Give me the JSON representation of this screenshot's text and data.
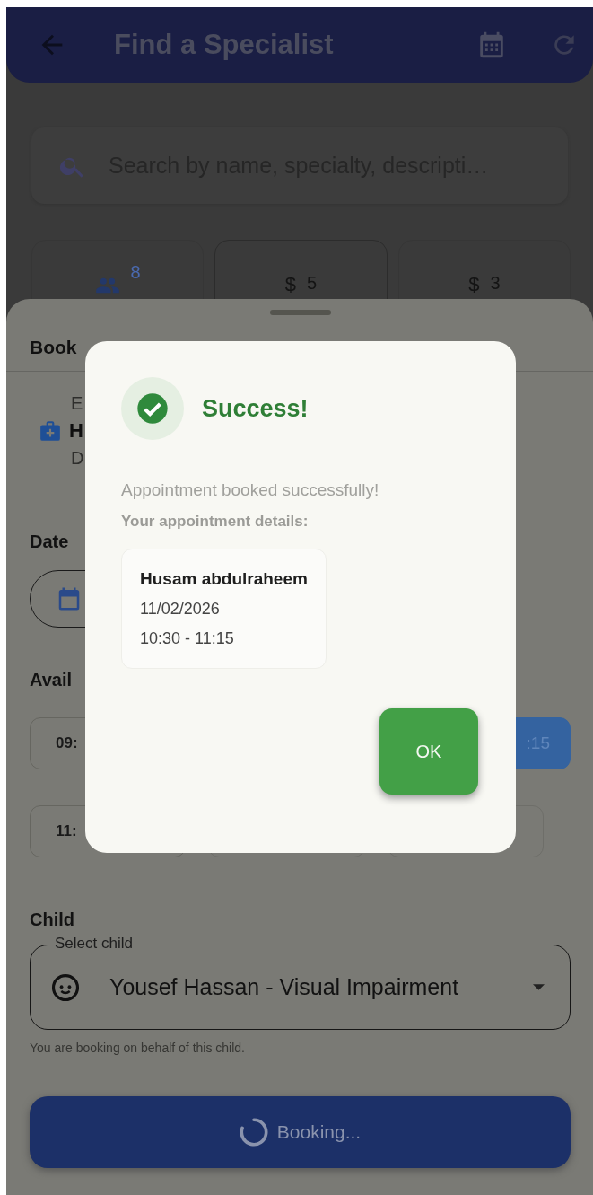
{
  "app_bar": {
    "title": "Find a Specialist"
  },
  "search": {
    "placeholder": "Search by name, specialty, descripti…"
  },
  "stats": [
    {
      "kind": "people",
      "value": "8"
    },
    {
      "kind": "dollar",
      "symbol": "$",
      "value": "5"
    },
    {
      "kind": "dollar",
      "symbol": "$",
      "value": "3"
    }
  ],
  "sheet": {
    "title": "Book",
    "specialist": {
      "line_1": "E",
      "name": "H",
      "line_3": "D"
    },
    "date_label": "Date",
    "slots_label": "Avail",
    "slot_rows": [
      {
        "slots": [
          {
            "kind": "partial",
            "label": "09:",
            "selected": false
          },
          {
            "kind": "partial",
            "label": ":15",
            "selected": true
          }
        ]
      },
      {
        "slots": [
          {
            "kind": "partial",
            "label": "11:",
            "selected": false
          },
          {
            "kind": "covered"
          },
          {
            "kind": "covered"
          }
        ]
      }
    ],
    "child": {
      "label": "Child",
      "field_label": "Select child",
      "value": "Yousef Hassan - Visual Impairment",
      "helper": "You are booking on behalf of this child."
    },
    "submit": {
      "label": "Booking...",
      "loading": true
    }
  },
  "dialog": {
    "title": "Success!",
    "message": "Appointment booked successfully!",
    "details_heading": "Your appointment details:",
    "details": {
      "name": "Husam abdulraheem",
      "date": "11/02/2026",
      "time": "10:30 - 11:15"
    },
    "button": "OK"
  }
}
